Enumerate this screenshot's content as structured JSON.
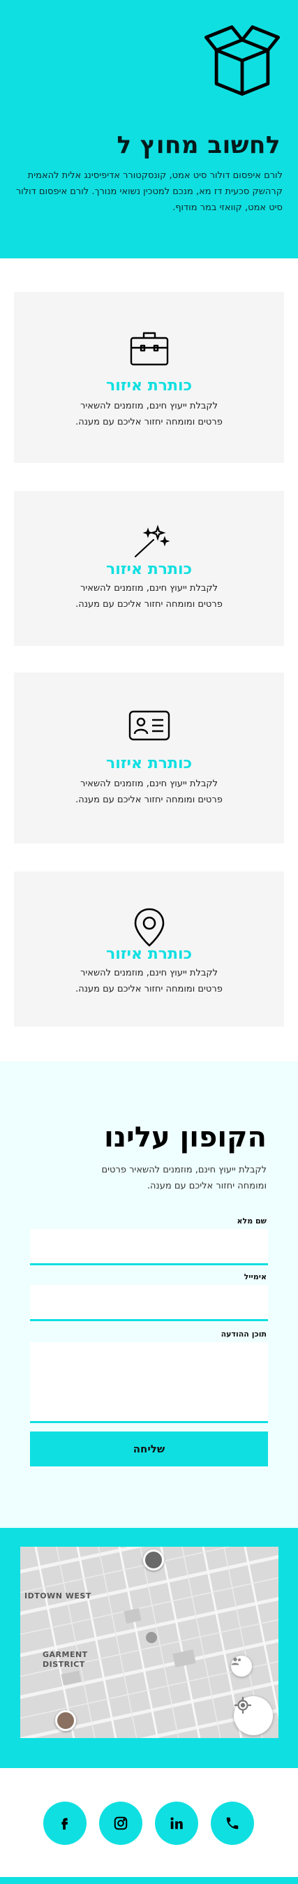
{
  "hero": {
    "title": "לחשוב מחוץ ל",
    "text": "לורם איפסום דולור סיט אמט, קונסקטורר אדיפיסינג אלית להאמית קרהשק סכעית דז מא, מנכם למטכין נשואי מנורך. לורם איפסום דולור סיט אמט, קוואזי במר מודוף."
  },
  "features": [
    {
      "icon": "briefcase-icon",
      "title": "כותרת איזור",
      "text": "לקבלת ייעוץ חינם, מוזמנים להשאיר פרטים ומומחה יחזור אליכם עם מענה."
    },
    {
      "icon": "magic-wand-icon",
      "title": "כותרת איזור",
      "text": "לקבלת ייעוץ חינם, מוזמנים להשאיר פרטים ומומחה יחזור אליכם עם מענה."
    },
    {
      "icon": "id-card-icon",
      "title": "כותרת איזור",
      "text": "לקבלת ייעוץ חינם, מוזמנים להשאיר פרטים ומומחה יחזור אליכם עם מענה."
    },
    {
      "icon": "location-pin-icon",
      "title": "כותרת איזור",
      "text": "לקבלת ייעוץ חינם, מוזמנים להשאיר פרטים ומומחה יחזור אליכם עם מענה."
    }
  ],
  "coupon": {
    "title": "הקופון עלינו",
    "subtitle": "לקבלת ייעוץ חינם, מוזמנים להשאיר פרטים ומומחה יחזור אליכם עם מענה.",
    "fields": {
      "name_label": "שם מלא",
      "email_label": "אימייל",
      "message_label": "תוכן ההודעה"
    },
    "submit_label": "שליחה"
  },
  "map": {
    "label_midtown": "IDTOWN WEST",
    "label_garment_1": "GARMENT",
    "label_garment_2": "DISTRICT"
  },
  "social": {
    "items": [
      "facebook-icon",
      "instagram-icon",
      "linkedin-icon",
      "phone-icon"
    ]
  },
  "colors": {
    "accent": "#10dfe1",
    "card_bg": "#f5f5f5",
    "form_bg": "#effefe"
  }
}
